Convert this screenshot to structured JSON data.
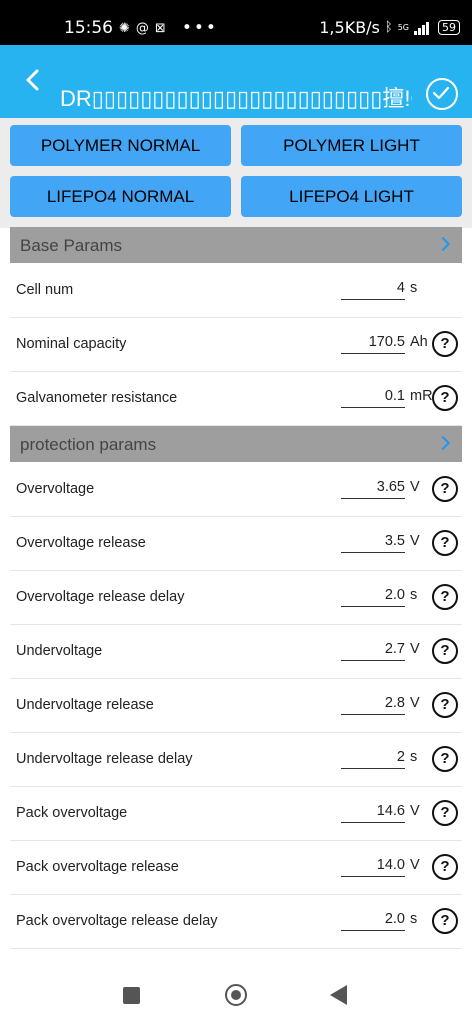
{
  "status_bar": {
    "time": "15:56",
    "left_icons": [
      "messenger-icon",
      "at-icon",
      "outlook-icon",
      "more-dots-icon"
    ],
    "net_speed": "1,5KB/s",
    "network": "5G",
    "battery": "59"
  },
  "app_bar": {
    "title": "DR\u0000\u0000\u0000\u0000\u0000\u0000\u0000\u0000\u0000\u0000\u0000\u0000\u0000\u0000\u0000\u0000\u0000\u0000\u0000\u0000\u0000\u0000\u0000\u0000\u0000擅!C瘻",
    "title_display": "DR▯▯▯▯▯▯▯▯▯▯▯▯▯▯▯▯▯▯▯▯▯▯▯▯擅!C瘻",
    "color": "#27b3ef"
  },
  "presets": [
    {
      "label": "POLYMER NORMAL"
    },
    {
      "label": "POLYMER LIGHT"
    },
    {
      "label": "LIFEPO4 NORMAL"
    },
    {
      "label": "LIFEPO4 LIGHT"
    }
  ],
  "sections": {
    "base": {
      "title": "Base Params"
    },
    "protection": {
      "title": "protection params"
    }
  },
  "base_params": [
    {
      "label": "Cell num",
      "value": "4",
      "unit": "s",
      "help": false
    },
    {
      "label": "Nominal capacity",
      "value": "170.5",
      "unit": "Ah",
      "help": true
    },
    {
      "label": "Galvanometer resistance",
      "value": "0.1",
      "unit": "mR",
      "help": true
    }
  ],
  "protection_params": [
    {
      "label": "Overvoltage",
      "value": "3.65",
      "unit": "V",
      "help": true
    },
    {
      "label": "Overvoltage release",
      "value": "3.5",
      "unit": "V",
      "help": true
    },
    {
      "label": "Overvoltage release delay",
      "value": "2.0",
      "unit": "s",
      "help": true
    },
    {
      "label": "Undervoltage",
      "value": "2.7",
      "unit": "V",
      "help": true
    },
    {
      "label": "Undervoltage release",
      "value": "2.8",
      "unit": "V",
      "help": true
    },
    {
      "label": "Undervoltage release delay",
      "value": "2",
      "unit": "s",
      "help": true
    },
    {
      "label": "Pack overvoltage",
      "value": "14.6",
      "unit": "V",
      "help": true
    },
    {
      "label": "Pack overvoltage release",
      "value": "14.0",
      "unit": "V",
      "help": true
    },
    {
      "label": "Pack overvoltage release delay",
      "value": "2.0",
      "unit": "s",
      "help": true
    }
  ],
  "help_glyph": "?",
  "nav": [
    "recents-button",
    "home-button",
    "back-button"
  ]
}
